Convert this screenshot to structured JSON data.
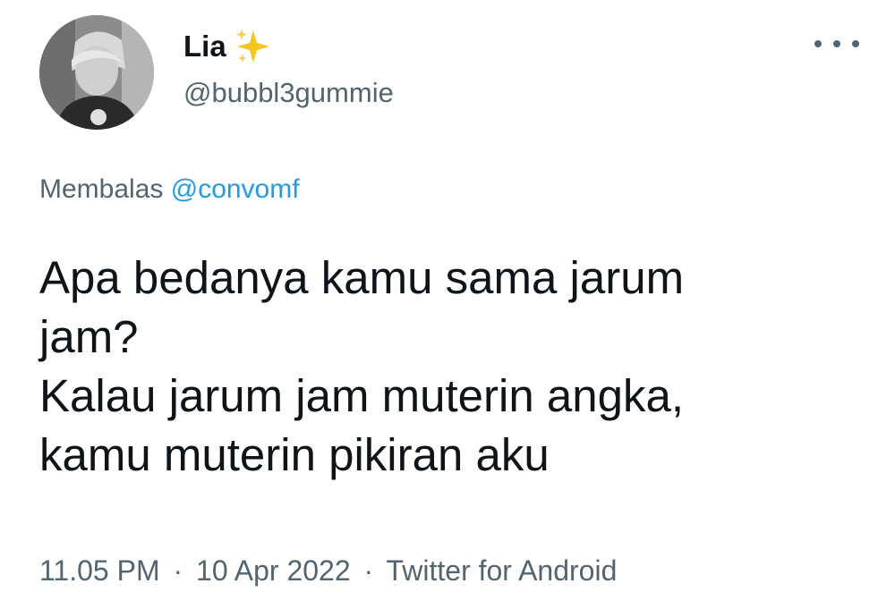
{
  "user": {
    "display_name": "Lia",
    "handle": "@bubbl3gummie",
    "avatar_icon": "profile-photo",
    "badge_icon": "sparkles-emoji"
  },
  "reply": {
    "prefix": "Membalas",
    "mention": "@convomf"
  },
  "tweet": {
    "lines": [
      "Apa bedanya kamu sama jarum",
      "jam?",
      "Kalau jarum jam muterin angka,",
      "kamu muterin pikiran aku"
    ]
  },
  "meta": {
    "time": "11.05 PM",
    "separator": "·",
    "date": "10 Apr 2022",
    "source": "Twitter for Android"
  },
  "colors": {
    "text": "#0f1419",
    "secondary": "#536471",
    "link": "#1d9bf0",
    "sparkle": "#f5c518"
  }
}
